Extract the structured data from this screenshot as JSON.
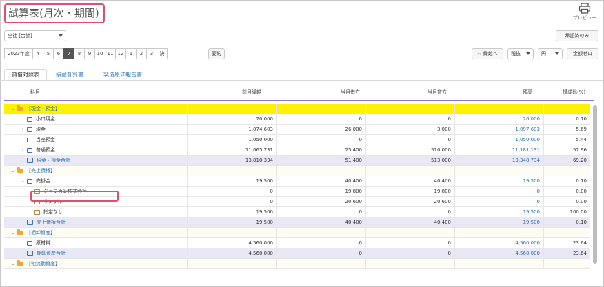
{
  "header": {
    "title": "試算表(月次・期間)",
    "preview_label": "プレビュー"
  },
  "toolbar": {
    "company_select": "全社 [合計]",
    "approved_only_label": "承認済のみ",
    "periods": [
      "2023年度",
      "4",
      "5",
      "6",
      "7",
      "8",
      "9",
      "10",
      "11",
      "12",
      "1",
      "2",
      "3",
      "決"
    ],
    "active_period": "7",
    "summary_label": "要約",
    "carry_label": "繰越へ",
    "tax_select": "税抜",
    "unit_select": "円",
    "zero_label": "金額ゼロ"
  },
  "tabs": [
    "貸借対照表",
    "損益計算書",
    "製造原価報告書"
  ],
  "columns": [
    "科目",
    "前月繰越",
    "当月借方",
    "当月貸方",
    "残高",
    "構成比(%)"
  ],
  "rows": [
    {
      "type": "cat0",
      "label": "【現金・預金】",
      "v": [
        "",
        "",
        "",
        "",
        ""
      ]
    },
    {
      "type": "acct",
      "label": "小口現金",
      "v": [
        "20,000",
        "0",
        "0",
        "20,000",
        "0.10"
      ]
    },
    {
      "type": "acct",
      "label": "現金",
      "v": [
        "1,074,603",
        "26,000",
        "3,000",
        "1,097,603",
        "5.69"
      ],
      "chev": "›"
    },
    {
      "type": "acct",
      "label": "当座預金",
      "v": [
        "1,050,000",
        "0",
        "0",
        "1,050,000",
        "5.44"
      ]
    },
    {
      "type": "acct",
      "label": "普通預金",
      "v": [
        "11,665,731",
        "25,400",
        "510,000",
        "11,181,131",
        "57.96"
      ],
      "chev": "›"
    },
    {
      "type": "total",
      "label": "現金・預金合計",
      "v": [
        "13,810,334",
        "51,400",
        "513,000",
        "13,348,734",
        "69.20"
      ]
    },
    {
      "type": "cat",
      "label": "【売上債権】",
      "v": [
        "",
        "",
        "",
        "",
        ""
      ]
    },
    {
      "type": "acct",
      "label": "売掛金",
      "v": [
        "19,500",
        "40,400",
        "40,400",
        "19,500",
        "0.10"
      ],
      "chev": "⌄"
    },
    {
      "type": "sub",
      "label": "ジョブカン株式会社",
      "v": [
        "0",
        "19,800",
        "19,800",
        "0",
        "0.00"
      ]
    },
    {
      "type": "sub",
      "label": "サンプル",
      "v": [
        "0",
        "20,600",
        "20,600",
        "0",
        "0.00"
      ]
    },
    {
      "type": "sub",
      "label": "指定なし",
      "v": [
        "19,500",
        "0",
        "0",
        "19,500",
        "100.00"
      ]
    },
    {
      "type": "total",
      "label": "売上債権合計",
      "v": [
        "19,500",
        "40,400",
        "40,400",
        "19,500",
        "0.10"
      ]
    },
    {
      "type": "cat",
      "label": "【棚卸資産】",
      "v": [
        "",
        "",
        "",
        "",
        ""
      ]
    },
    {
      "type": "acct",
      "label": "原材料",
      "v": [
        "4,560,000",
        "0",
        "0",
        "4,560,000",
        "23.64"
      ]
    },
    {
      "type": "total",
      "label": "棚卸資産合計",
      "v": [
        "4,560,000",
        "0",
        "0",
        "4,560,000",
        "23.64"
      ]
    },
    {
      "type": "cat",
      "label": "【他流動資産】",
      "v": [
        "",
        "",
        "",
        "",
        ""
      ]
    }
  ]
}
